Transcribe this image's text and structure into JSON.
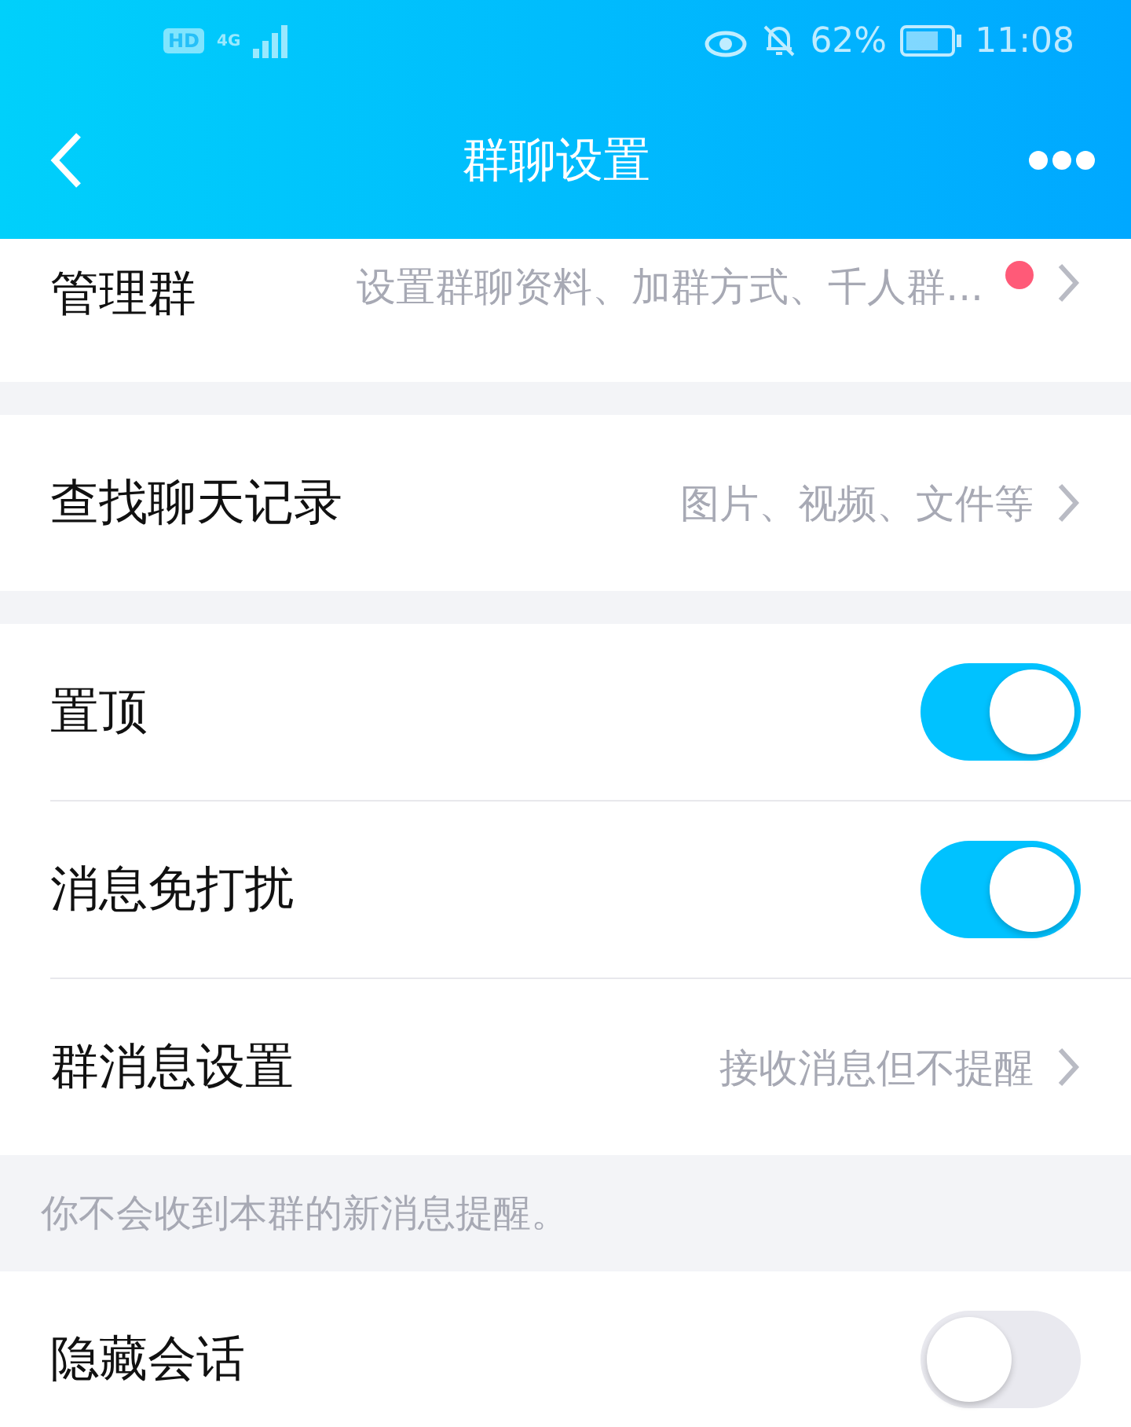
{
  "status_bar": {
    "hd": "HD",
    "network": "4G",
    "battery": "62%",
    "time": "11:08"
  },
  "header": {
    "title": "群聊设置"
  },
  "sections": [
    {
      "rows": [
        {
          "kind": "link",
          "label": "管理群",
          "value": "设置群聊资料、加群方式、千人群...",
          "badge": true
        }
      ]
    },
    {
      "rows": [
        {
          "kind": "link",
          "label": "查找聊天记录",
          "value": "图片、视频、文件等",
          "badge": false
        }
      ]
    },
    {
      "rows": [
        {
          "kind": "toggle",
          "label": "置顶",
          "on": true
        },
        {
          "kind": "toggle",
          "label": "消息免打扰",
          "on": true
        },
        {
          "kind": "link",
          "label": "群消息设置",
          "value": "接收消息但不提醒",
          "badge": false
        }
      ],
      "note": "你不会收到本群的新消息提醒。"
    },
    {
      "rows": [
        {
          "kind": "toggle",
          "label": "隐藏会话",
          "on": false
        }
      ]
    }
  ]
}
